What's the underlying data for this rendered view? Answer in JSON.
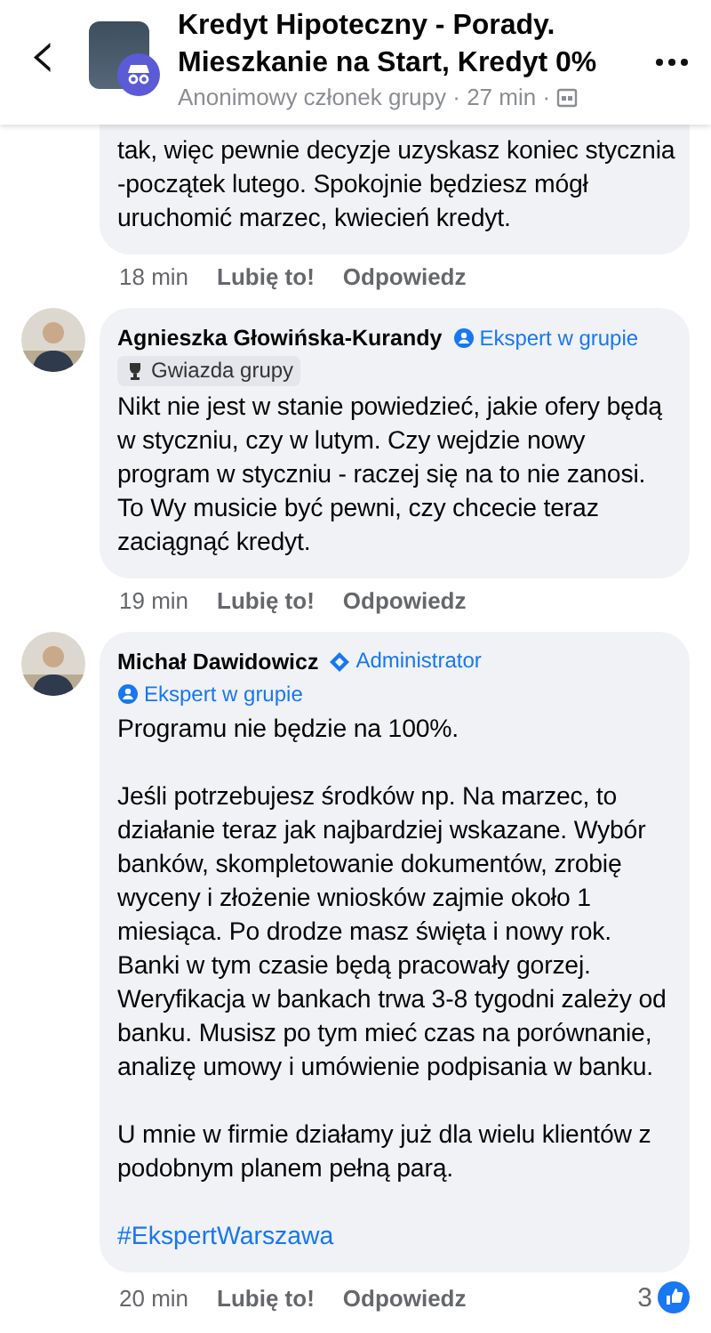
{
  "header": {
    "back": "‹",
    "title": "Kredyt Hipoteczny - Porady. Mieszkanie na Start, Kredyt 0%",
    "subtitle": "Anonimowy członek grupy · 27 min ·"
  },
  "comments": [
    {
      "kind": "continued",
      "paragraphs": [
        "tak,  więc pewnie decyzje uzyskasz koniec stycznia -początek lutego. Spokojnie będziesz mógł uruchomić marzec, kwiecień kredyt."
      ],
      "time": "18 min",
      "like": "Lubię to!",
      "reply": "Odpowiedz"
    },
    {
      "kind": "full",
      "author": "Agnieszka Głowińska-Kurandy",
      "badges": [
        {
          "kind": "expert",
          "label": "Ekspert w grupie"
        },
        {
          "kind": "star",
          "label": "Gwiazda grupy"
        }
      ],
      "paragraphs": [
        "Nikt nie jest w stanie powiedzieć, jakie ofery będą w styczniu, czy w lutym. Czy wejdzie nowy program w styczniu - raczej się na to nie zanosi. To Wy musicie być pewni, czy chcecie teraz zaciągnąć kredyt."
      ],
      "time": "19 min",
      "like": "Lubię to!",
      "reply": "Odpowiedz"
    },
    {
      "kind": "full",
      "author": "Michał Dawidowicz",
      "badges": [
        {
          "kind": "admin",
          "label": "Administrator"
        },
        {
          "kind": "expert",
          "label": "Ekspert w grupie"
        }
      ],
      "paragraphs": [
        "Programu nie będzie na 100%.",
        "Jeśli  potrzebujesz środków np. Na marzec, to działanie teraz jak najbardziej wskazane. Wybór banków, skompletowanie dokumentów, zrobię wyceny i złożenie wniosków zajmie około 1 miesiąca. Po drodze masz święta i nowy rok. Banki w tym czasie będą pracowały gorzej. Weryfikacja w bankach trwa 3-8 tygodni zależy od banku. Musisz po tym mieć czas na porównanie, analizę umowy i umówienie podpisania w banku.",
        "U mnie w firmie działamy już dla wielu klientów z podobnym planem pełną parą."
      ],
      "hashtag": "#EkspertWarszawa",
      "time": "20 min",
      "like": "Lubię to!",
      "reply": "Odpowiedz",
      "reactions": "3"
    }
  ]
}
